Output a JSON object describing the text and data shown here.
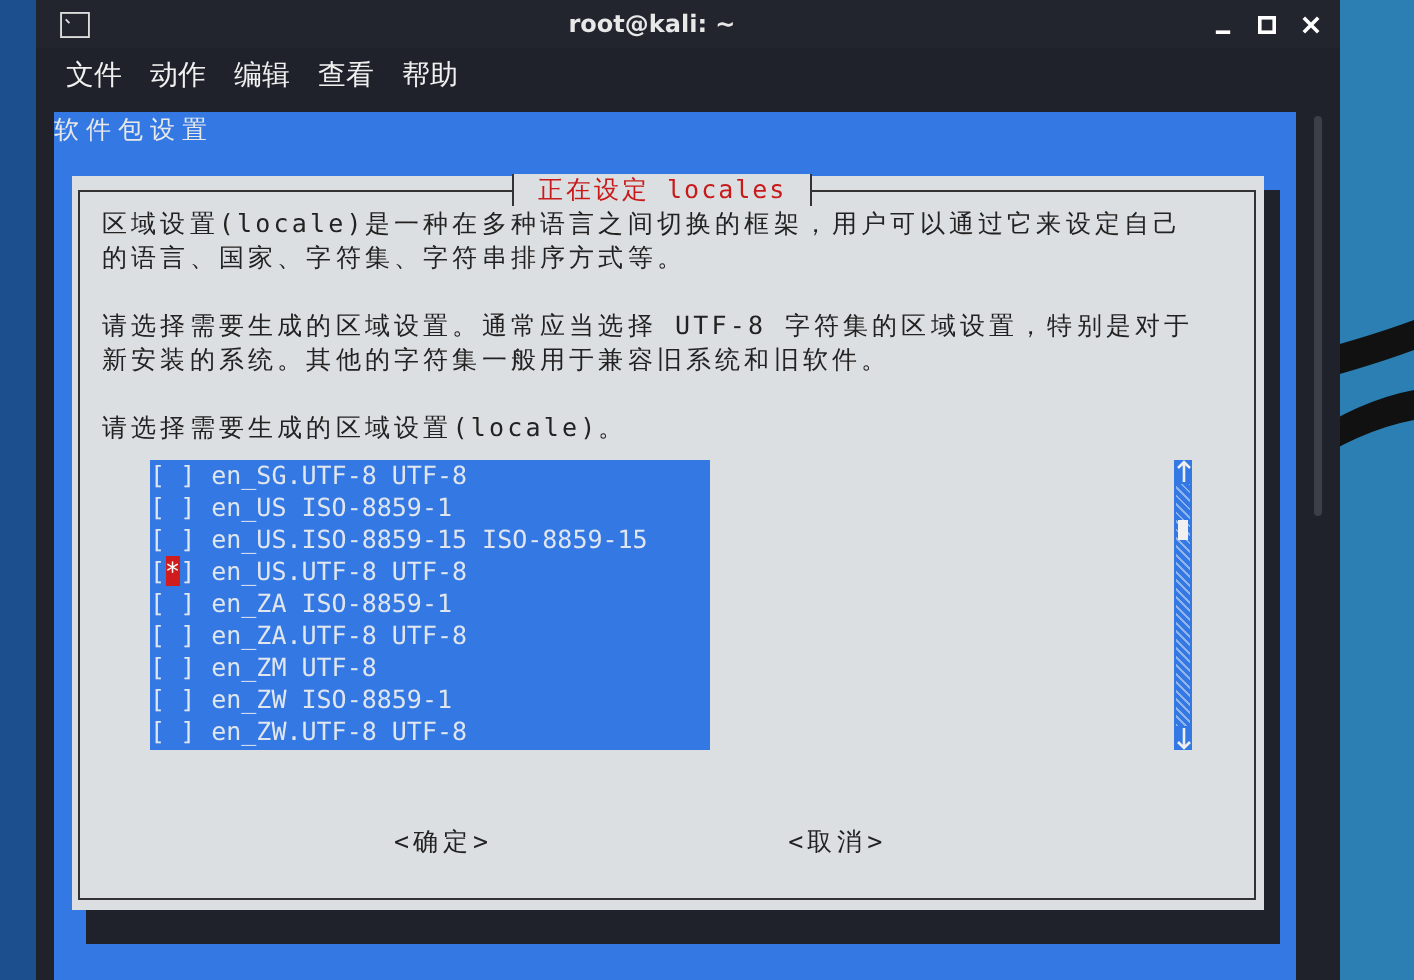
{
  "window": {
    "title": "root@kali: ~"
  },
  "menu": [
    "文件",
    "动作",
    "编辑",
    "查看",
    "帮助"
  ],
  "terminal": {
    "backtitle": "软件包设置",
    "dialog": {
      "title": "正在设定 locales",
      "paragraphs": [
        "区域设置(locale)是一种在多种语言之间切换的框架，用户可以通过它来设定自己的语言、国家、字符集、字符串排序方式等。",
        "请选择需要生成的区域设置。通常应当选择 UTF-8 字符集的区域设置，特别是对于新安装的系统。其他的字符集一般用于兼容旧系统和旧软件。",
        "请选择需要生成的区域设置(locale)。"
      ],
      "items": [
        {
          "box": "[ ]",
          "label": "en_SG.UTF-8 UTF-8",
          "selected": false
        },
        {
          "box": "[ ]",
          "label": "en_US ISO-8859-1",
          "selected": false
        },
        {
          "box": "[ ]",
          "label": "en_US.ISO-8859-15 ISO-8859-15",
          "selected": false
        },
        {
          "box": "[*]",
          "label": "en_US.UTF-8 UTF-8",
          "selected": true
        },
        {
          "box": "[ ]",
          "label": "en_ZA ISO-8859-1",
          "selected": false
        },
        {
          "box": "[ ]",
          "label": "en_ZA.UTF-8 UTF-8",
          "selected": false
        },
        {
          "box": "[ ]",
          "label": "en_ZM UTF-8",
          "selected": false
        },
        {
          "box": "[ ]",
          "label": "en_ZW ISO-8859-1",
          "selected": false
        },
        {
          "box": "[ ]",
          "label": "en_ZW.UTF-8 UTF-8",
          "selected": false
        }
      ],
      "buttons": [
        {
          "label": "<确定>",
          "selected": false
        },
        {
          "label": "<取消>",
          "selected": false
        }
      ]
    }
  }
}
